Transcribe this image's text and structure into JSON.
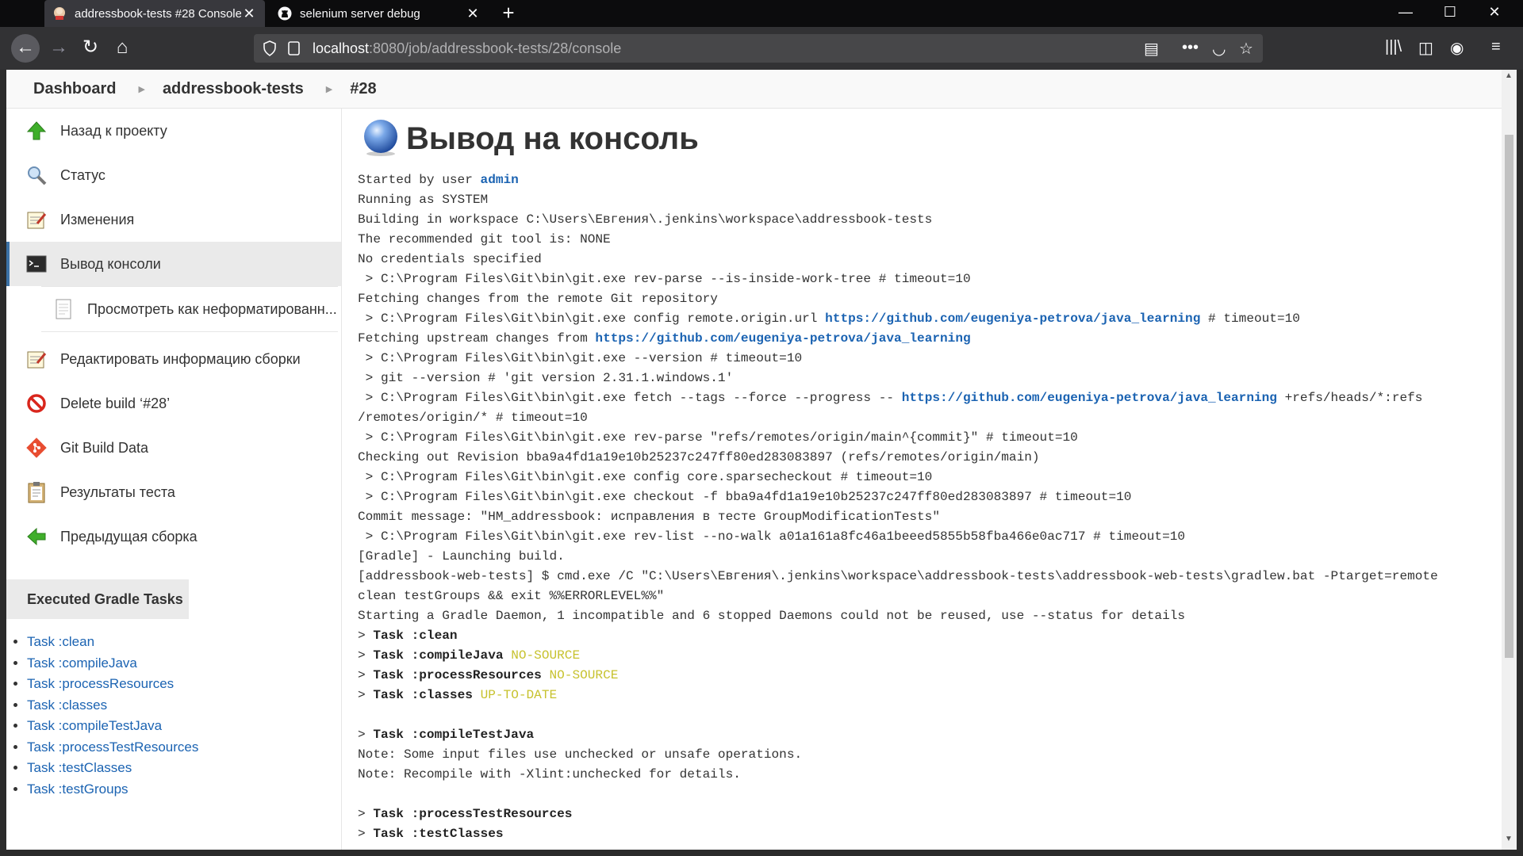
{
  "browser": {
    "tabs": [
      {
        "title": "addressbook-tests #28 Console",
        "active": true
      },
      {
        "title": "selenium server debug",
        "active": false
      }
    ],
    "url": {
      "host": "localhost",
      "rest": ":8080/job/addressbook-tests/28/console"
    }
  },
  "breadcrumbs": [
    "Dashboard",
    "addressbook-tests",
    "#28"
  ],
  "side": {
    "tasks": [
      {
        "label": "Назад к проекту",
        "icon": "up-arrow-icon"
      },
      {
        "label": "Статус",
        "icon": "magnifier-icon"
      },
      {
        "label": "Изменения",
        "icon": "notepad-icon"
      },
      {
        "label": "Вывод консоли",
        "icon": "terminal-icon"
      },
      {
        "label": "Просмотреть как неформатированн...",
        "icon": "document-icon"
      },
      {
        "label": "Редактировать информацию сборки",
        "icon": "notepad-icon"
      },
      {
        "label": "Delete build ‘#28’",
        "icon": "no-entry-icon"
      },
      {
        "label": "Git Build Data",
        "icon": "git-icon"
      },
      {
        "label": "Результаты теста",
        "icon": "clipboard-icon"
      },
      {
        "label": "Предыдущая сборка",
        "icon": "left-arrow-icon"
      }
    ],
    "gradle_title": "Executed Gradle Tasks",
    "gradle_tasks": [
      "Task :clean",
      "Task :compileJava",
      "Task :processResources",
      "Task :classes",
      "Task :compileTestJava",
      "Task :processTestResources",
      "Task :testClasses",
      "Task :testGroups"
    ]
  },
  "main": {
    "title": "Вывод на консоль",
    "console": [
      [
        {
          "t": "Started by user "
        },
        {
          "t": "admin",
          "k": "link"
        }
      ],
      [
        {
          "t": "Running as SYSTEM"
        }
      ],
      [
        {
          "t": "Building in workspace C:\\Users\\Евгения\\.jenkins\\workspace\\addressbook-tests"
        }
      ],
      [
        {
          "t": "The recommended git tool is: NONE"
        }
      ],
      [
        {
          "t": "No credentials specified"
        }
      ],
      [
        {
          "t": " > C:\\Program Files\\Git\\bin\\git.exe rev-parse --is-inside-work-tree # timeout=10"
        }
      ],
      [
        {
          "t": "Fetching changes from the remote Git repository"
        }
      ],
      [
        {
          "t": " > C:\\Program Files\\Git\\bin\\git.exe config remote.origin.url "
        },
        {
          "t": "https://github.com/eugeniya-petrova/java_learning",
          "k": "link"
        },
        {
          "t": " # timeout=10"
        }
      ],
      [
        {
          "t": "Fetching upstream changes from "
        },
        {
          "t": "https://github.com/eugeniya-petrova/java_learning",
          "k": "link"
        }
      ],
      [
        {
          "t": " > C:\\Program Files\\Git\\bin\\git.exe --version # timeout=10"
        }
      ],
      [
        {
          "t": " > git --version # 'git version 2.31.1.windows.1'"
        }
      ],
      [
        {
          "t": " > C:\\Program Files\\Git\\bin\\git.exe fetch --tags --force --progress -- "
        },
        {
          "t": "https://github.com/eugeniya-petrova/java_learning",
          "k": "link"
        },
        {
          "t": " +refs/heads/*:refs"
        }
      ],
      [
        {
          "t": "/remotes/origin/* # timeout=10"
        }
      ],
      [
        {
          "t": " > C:\\Program Files\\Git\\bin\\git.exe rev-parse \"refs/remotes/origin/main^{commit}\" # timeout=10"
        }
      ],
      [
        {
          "t": "Checking out Revision bba9a4fd1a19e10b25237c247ff80ed283083897 (refs/remotes/origin/main)"
        }
      ],
      [
        {
          "t": " > C:\\Program Files\\Git\\bin\\git.exe config core.sparsecheckout # timeout=10"
        }
      ],
      [
        {
          "t": " > C:\\Program Files\\Git\\bin\\git.exe checkout -f bba9a4fd1a19e10b25237c247ff80ed283083897 # timeout=10"
        }
      ],
      [
        {
          "t": "Commit message: \"HM_addressbook: исправления в тесте GroupModificationTests\""
        }
      ],
      [
        {
          "t": " > C:\\Program Files\\Git\\bin\\git.exe rev-list --no-walk a01a161a8fc46a1beeed5855b58fba466e0ac717 # timeout=10"
        }
      ],
      [
        {
          "t": "[Gradle] - Launching build."
        }
      ],
      [
        {
          "t": "[addressbook-web-tests] $ cmd.exe /C \"C:\\Users\\Евгения\\.jenkins\\workspace\\addressbook-tests\\addressbook-web-tests\\gradlew.bat -Ptarget=remote"
        }
      ],
      [
        {
          "t": "clean testGroups && exit %%ERRORLEVEL%%\""
        }
      ],
      [
        {
          "t": "Starting a Gradle Daemon, 1 incompatible and 6 stopped Daemons could not be reused, use --status for details"
        }
      ],
      [
        {
          "t": "> "
        },
        {
          "t": "Task :clean",
          "k": "bold"
        }
      ],
      [
        {
          "t": "> "
        },
        {
          "t": "Task :compileJava",
          "k": "bold"
        },
        {
          "t": " "
        },
        {
          "t": "NO-SOURCE",
          "k": "status"
        }
      ],
      [
        {
          "t": "> "
        },
        {
          "t": "Task :processResources",
          "k": "bold"
        },
        {
          "t": " "
        },
        {
          "t": "NO-SOURCE",
          "k": "status"
        }
      ],
      [
        {
          "t": "> "
        },
        {
          "t": "Task :classes",
          "k": "bold"
        },
        {
          "t": " "
        },
        {
          "t": "UP-TO-DATE",
          "k": "status"
        }
      ],
      [],
      [
        {
          "t": "> "
        },
        {
          "t": "Task :compileTestJava",
          "k": "bold"
        }
      ],
      [
        {
          "t": "Note: Some input files use unchecked or unsafe operations."
        }
      ],
      [
        {
          "t": "Note: Recompile with -Xlint:unchecked for details."
        }
      ],
      [],
      [
        {
          "t": "> "
        },
        {
          "t": "Task :processTestResources",
          "k": "bold"
        }
      ],
      [
        {
          "t": "> "
        },
        {
          "t": "Task :testClasses",
          "k": "bold"
        }
      ]
    ]
  },
  "colors": {
    "link": "#1b63b2",
    "status": "#c7c22e",
    "accent": "#3c72a6"
  }
}
